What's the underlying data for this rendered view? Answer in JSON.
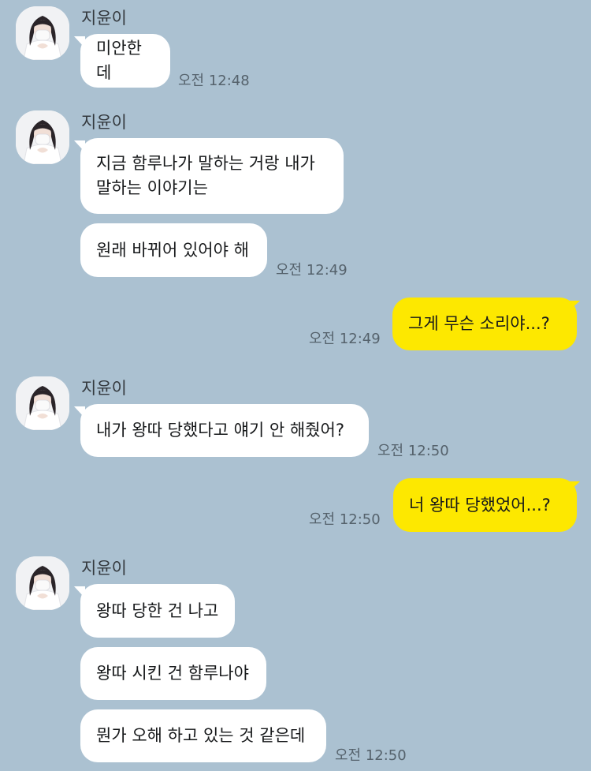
{
  "theme": {
    "background": "#abc1d1",
    "incoming_bubble": "#ffffff",
    "outgoing_bubble": "#fde800"
  },
  "sender_name": "지윤이",
  "messages": [
    {
      "from": "friend",
      "text": "미안한데",
      "time": "오전 12:48"
    },
    {
      "from": "friend",
      "text": "지금 함루나가 말하는 거랑 내가\n말하는 이야기는",
      "time": ""
    },
    {
      "from": "friend",
      "text": "원래 바뀌어 있어야 해",
      "time": "오전 12:49"
    },
    {
      "from": "me",
      "text": "그게 무슨 소리야...?",
      "time": "오전 12:49"
    },
    {
      "from": "friend",
      "text": "내가 왕따 당했다고 얘기 안 해줬어?",
      "time": "오전 12:50"
    },
    {
      "from": "me",
      "text": "너 왕따 당했었어...?",
      "time": "오전 12:50"
    },
    {
      "from": "friend",
      "text": "왕따 당한 건 나고",
      "time": ""
    },
    {
      "from": "friend",
      "text": "왕따 시킨 건 함루나야",
      "time": ""
    },
    {
      "from": "friend",
      "text": "뭔가 오해 하고 있는 것 같은데",
      "time": "오전 12:50"
    }
  ]
}
